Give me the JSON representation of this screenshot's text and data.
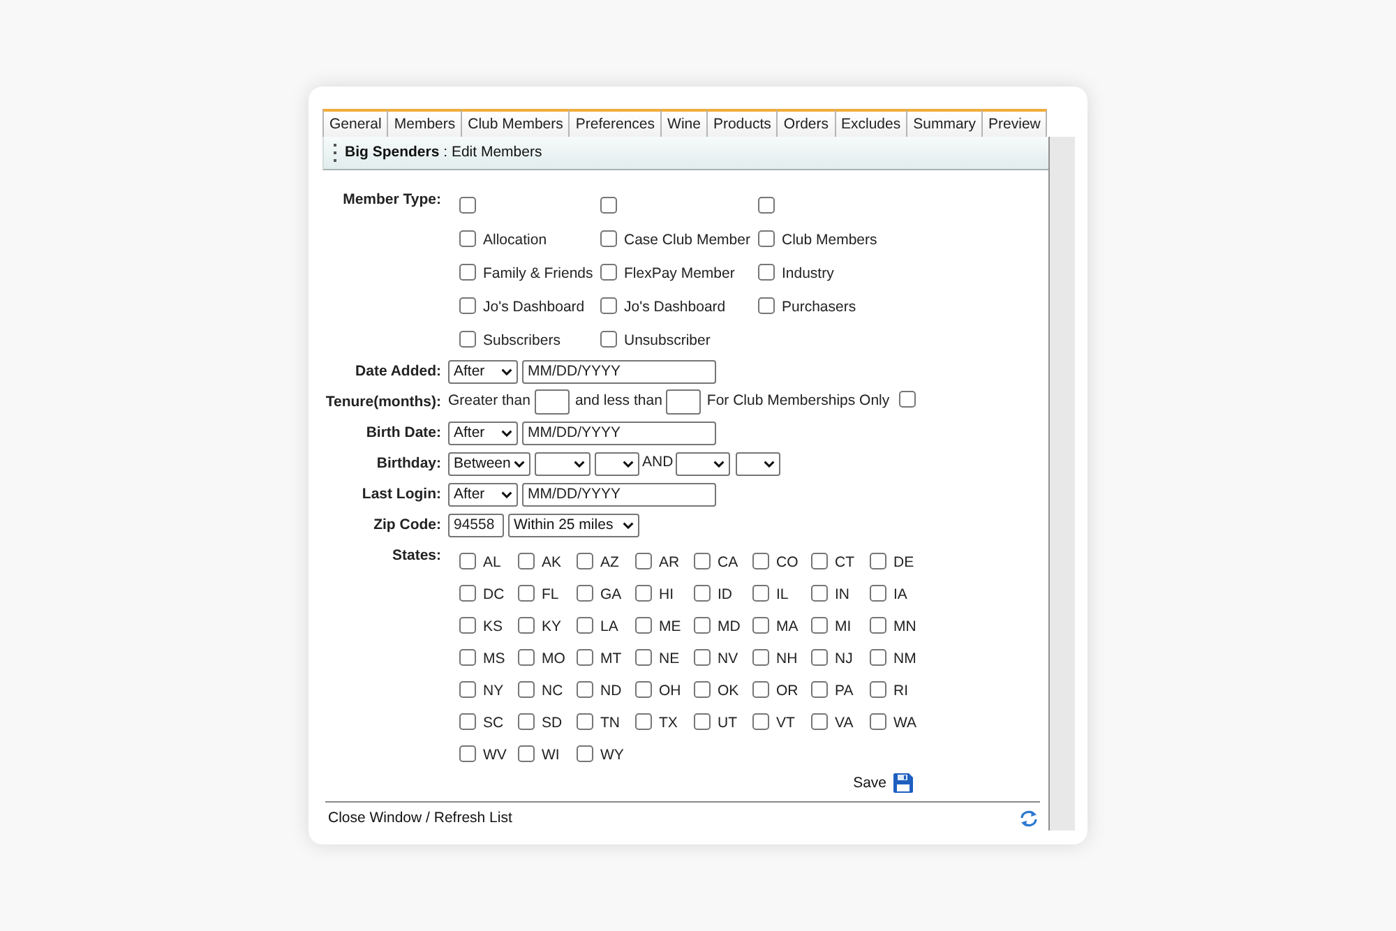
{
  "tabs": [
    {
      "label": "General",
      "selected": false
    },
    {
      "label": "Members",
      "selected": false
    },
    {
      "label": "Club Members",
      "selected": false
    },
    {
      "label": "Preferences",
      "selected": false
    },
    {
      "label": "Wine",
      "selected": false
    },
    {
      "label": "Products",
      "selected": false
    },
    {
      "label": "Orders",
      "selected": false
    },
    {
      "label": "Excludes",
      "selected": false
    },
    {
      "label": "Summary",
      "selected": false
    },
    {
      "label": "Preview",
      "selected": false
    }
  ],
  "panel": {
    "title": "**Big Spenders** : Edit Members"
  },
  "member_type": {
    "label": "Member Type:",
    "options": [
      {
        "checked": false
      },
      {
        "checked": false
      },
      {
        "checked": false
      },
      {
        "label": "Allocation",
        "checked": false
      },
      {
        "label": "Case Club Member",
        "checked": false
      },
      {
        "label": "Club Members",
        "checked": false
      },
      {
        "label": "Family & Friends",
        "checked": false
      },
      {
        "label": "FlexPay Member",
        "checked": false
      },
      {
        "label": "Industry",
        "checked": false
      },
      {
        "label": "Jo's Dashboard",
        "checked": false
      },
      {
        "label": "Jo's Dashboard",
        "checked": false
      },
      {
        "label": "Purchasers",
        "checked": false
      },
      {
        "label": "Subscribers",
        "checked": false
      },
      {
        "label": "Unsubscriber",
        "checked": false
      }
    ]
  },
  "filters": [
    {
      "kind": "date",
      "label": "Date Added:",
      "operator": "After",
      "value": "MM/DD/YYYY"
    },
    {
      "kind": "tenure",
      "label": "Tenure(months):",
      "greater_text": "Greater than",
      "less_text": "and less than",
      "club_text": "For Club Memberships Only",
      "club_only_checked": false
    },
    {
      "kind": "date",
      "label": "Birth Date:",
      "operator": "After",
      "value": "MM/DD/YYYY"
    },
    {
      "kind": "birthday",
      "label": "Birthday:",
      "operator": "Between",
      "joiner": "AND"
    },
    {
      "kind": "date",
      "label": "Last Login:",
      "operator": "After",
      "value": "MM/DD/YYYY"
    },
    {
      "kind": "zip",
      "label": "Zip Code:",
      "value": "94558",
      "radius": "Within 25 miles"
    }
  ],
  "states": {
    "label": "States:",
    "options": [
      {
        "label": "AL",
        "checked": false
      },
      {
        "label": "AK",
        "checked": false
      },
      {
        "label": "AZ",
        "checked": false
      },
      {
        "label": "AR",
        "checked": false
      },
      {
        "label": "CA",
        "checked": false
      },
      {
        "label": "CO",
        "checked": false
      },
      {
        "label": "CT",
        "checked": false
      },
      {
        "label": "DE",
        "checked": false
      },
      {
        "label": "DC",
        "checked": false
      },
      {
        "label": "FL",
        "checked": false
      },
      {
        "label": "GA",
        "checked": false
      },
      {
        "label": "HI",
        "checked": false
      },
      {
        "label": "ID",
        "checked": false
      },
      {
        "label": "IL",
        "checked": false
      },
      {
        "label": "IN",
        "checked": false
      },
      {
        "label": "IA",
        "checked": false
      },
      {
        "label": "KS",
        "checked": false
      },
      {
        "label": "KY",
        "checked": false
      },
      {
        "label": "LA",
        "checked": false
      },
      {
        "label": "ME",
        "checked": false
      },
      {
        "label": "MD",
        "checked": false
      },
      {
        "label": "MA",
        "checked": false
      },
      {
        "label": "MI",
        "checked": false
      },
      {
        "label": "MN",
        "checked": false
      },
      {
        "label": "MS",
        "checked": false
      },
      {
        "label": "MO",
        "checked": false
      },
      {
        "label": "MT",
        "checked": false
      },
      {
        "label": "NE",
        "checked": false
      },
      {
        "label": "NV",
        "checked": false
      },
      {
        "label": "NH",
        "checked": false
      },
      {
        "label": "NJ",
        "checked": false
      },
      {
        "label": "NM",
        "checked": false
      },
      {
        "label": "NY",
        "checked": false
      },
      {
        "label": "NC",
        "checked": false
      },
      {
        "label": "ND",
        "checked": false
      },
      {
        "label": "OH",
        "checked": false
      },
      {
        "label": "OK",
        "checked": false
      },
      {
        "label": "OR",
        "checked": false
      },
      {
        "label": "PA",
        "checked": false
      },
      {
        "label": "RI",
        "checked": false
      },
      {
        "label": "SC",
        "checked": false
      },
      {
        "label": "SD",
        "checked": false
      },
      {
        "label": "TN",
        "checked": false
      },
      {
        "label": "TX",
        "checked": false
      },
      {
        "label": "UT",
        "checked": false
      },
      {
        "label": "VT",
        "checked": false
      },
      {
        "label": "VA",
        "checked": false
      },
      {
        "label": "WA",
        "checked": false
      },
      {
        "label": "WV",
        "checked": false
      },
      {
        "label": "WI",
        "checked": false
      },
      {
        "label": "WY",
        "checked": false
      }
    ]
  },
  "save_button": "Save",
  "footer_link": "Close Window / Refresh List"
}
